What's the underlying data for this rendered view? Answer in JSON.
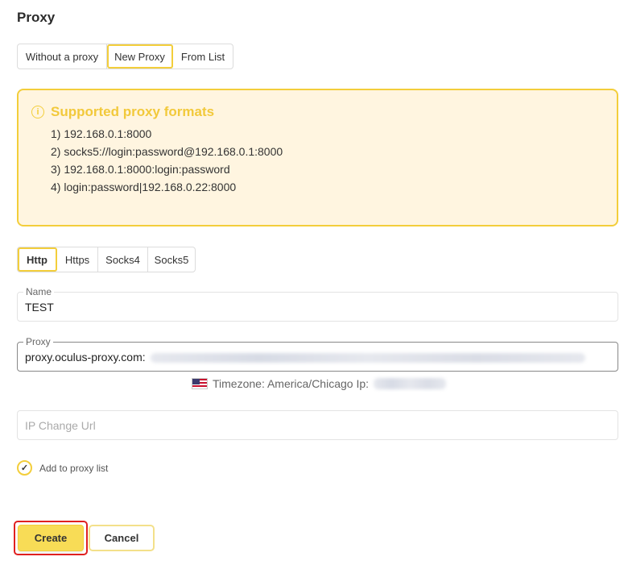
{
  "section_title": "Proxy",
  "mode_tabs": [
    "Without a proxy",
    "New Proxy",
    "From List"
  ],
  "mode_tabs_active": "New Proxy",
  "info": {
    "icon": "info-icon",
    "title": "Supported proxy formats",
    "formats": [
      "1) 192.168.0.1:8000",
      "2) socks5://login:password@192.168.0.1:8000",
      "3) 192.168.0.1:8000:login:password",
      "4) login:password|192.168.0.22:8000"
    ]
  },
  "protocol_tabs": [
    "Http",
    "Https",
    "Socks4",
    "Socks5"
  ],
  "protocol_active": "Http",
  "name_field": {
    "label": "Name",
    "value": "TEST"
  },
  "proxy_field": {
    "label": "Proxy",
    "value": "proxy.oculus-proxy.com:"
  },
  "timezone": {
    "flag": "us-flag-icon",
    "text": "Timezone: America/Chicago Ip:"
  },
  "ip_change_url": {
    "placeholder": "IP Change Url",
    "value": ""
  },
  "add_to_list": {
    "label": "Add to proxy list",
    "checked": true
  },
  "buttons": {
    "create": "Create",
    "cancel": "Cancel"
  },
  "colors": {
    "accent": "#f3ce3b",
    "info_bg": "#fff5e0",
    "highlight": "#e02020"
  }
}
